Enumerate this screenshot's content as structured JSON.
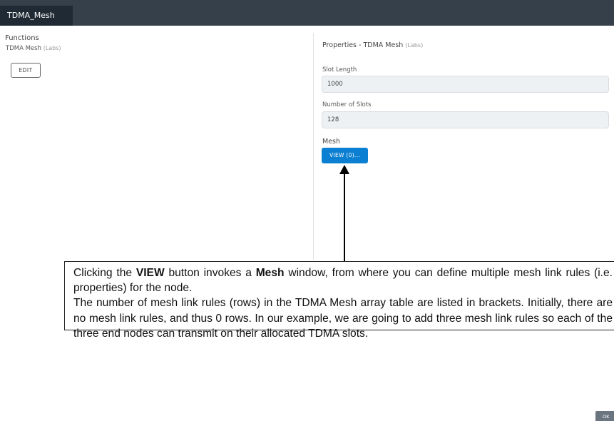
{
  "window": {
    "tab_label": "TDMA_Mesh"
  },
  "functions": {
    "title": "Functions",
    "item_name": "TDMA Mesh",
    "item_tag": "(Labs)",
    "edit_label": "EDIT"
  },
  "properties": {
    "title": "Properties  - TDMA Mesh",
    "title_tag": "(Labs)",
    "slot_length": {
      "label": "Slot Length",
      "value": "1000"
    },
    "number_of_slots": {
      "label": "Number of Slots",
      "value": "128"
    },
    "mesh": {
      "label": "Mesh",
      "button_label": "VIEW (0)..."
    }
  },
  "annotation": {
    "p1_pre": "Clicking the ",
    "p1_bold1": "VIEW",
    "p1_mid": " button invokes a ",
    "p1_bold2": "Mesh",
    "p1_post": " window, from where you can define multiple mesh link rules (i.e. properties) for the node.",
    "p2": "The number of mesh link rules (rows) in the TDMA Mesh array table are listed in brackets. Initially, there are no mesh link rules, and thus 0 rows. In our example, we are going to add three mesh link rules so each of the three end nodes can transmit on their allocated TDMA slots."
  },
  "footer": {
    "ok_label": "OK"
  },
  "colors": {
    "topbar": "#36404a",
    "active_tab": "#1f2a35",
    "view_button": "#0b7fd1",
    "ok_button": "#6b7580"
  }
}
